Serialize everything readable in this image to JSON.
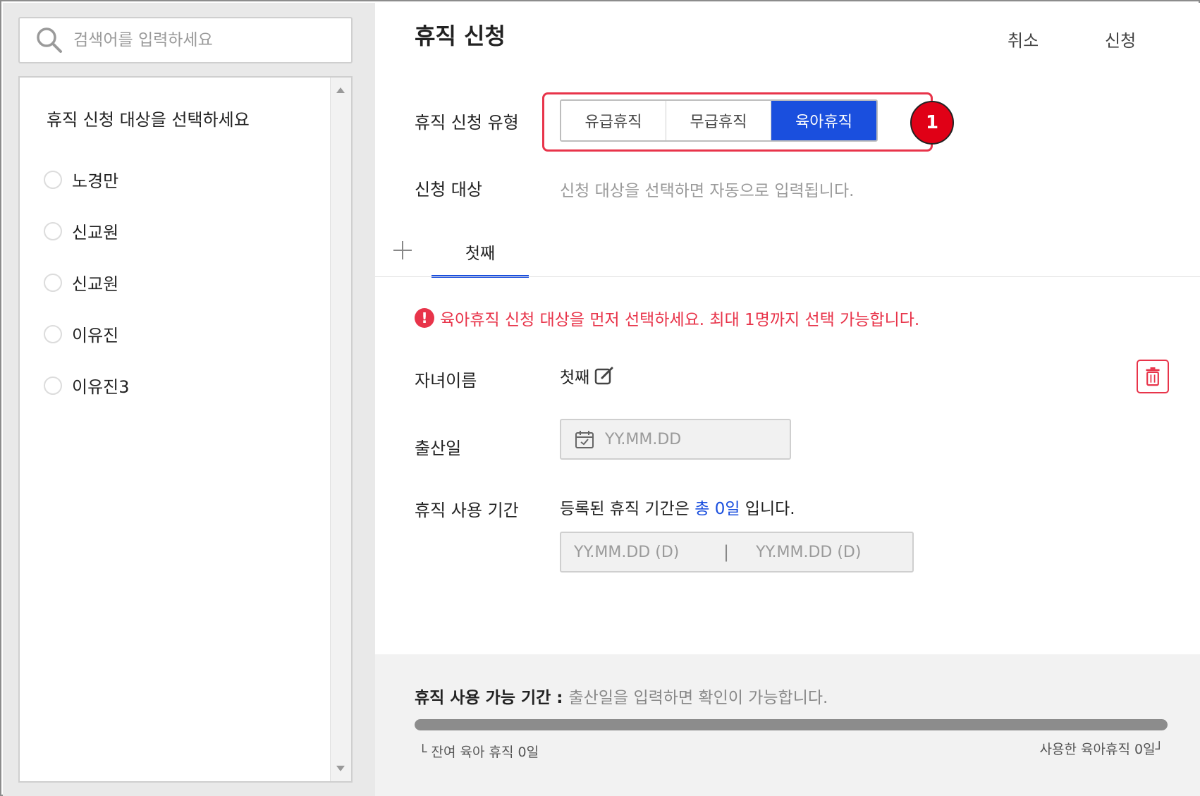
{
  "search": {
    "placeholder": "검색어를 입력하세요",
    "icon": "search-icon"
  },
  "target_list": {
    "title": "휴직 신청 대상을 선택하세요",
    "items": [
      {
        "label": "노경만"
      },
      {
        "label": "신교원"
      },
      {
        "label": "신교원"
      },
      {
        "label": "이유진"
      },
      {
        "label": "이유진3"
      }
    ]
  },
  "header": {
    "title": "휴직 신청",
    "cancel_label": "취소",
    "apply_label": "신청"
  },
  "form": {
    "type_label": "휴직 신청 유형",
    "type_options": [
      "유급휴직",
      "무급휴직",
      "육아휴직"
    ],
    "type_selected": "육아휴직",
    "marker": "1",
    "target_label": "신청 대상",
    "target_hint": "신청 대상을 선택하면 자동으로 입력됩니다."
  },
  "tabs": {
    "items": [
      {
        "label": "첫째"
      }
    ]
  },
  "warning": {
    "icon": "exclamation-icon",
    "text": "육아휴직 신청 대상을 먼저 선택하세요. 최대 1명까지 선택 가능합니다."
  },
  "child": {
    "name_label": "자녀이름",
    "name_value": "첫째",
    "birth_label": "출산일",
    "birth_placeholder": "YY.MM.DD",
    "period_label": "휴직 사용 기간",
    "period_prefix": "등록된 휴직 기간은 ",
    "period_total": "총 0일",
    "period_suffix": " 입니다.",
    "start_placeholder": "YY.MM.DD (D)",
    "end_placeholder": "YY.MM.DD (D)",
    "range_separator": "|"
  },
  "summary": {
    "available_key": "휴직 사용 가능 기간 : ",
    "available_value": "출산일을 입력하면 확인이 가능합니다.",
    "remaining_text": "└ 잔여 육아 휴직 0일",
    "used_text": "사용한 육아휴직 0일┘",
    "progress_fraction": 1.0
  },
  "colors": {
    "accent": "#1a4fde",
    "alert": "#e8344a",
    "marker": "#e00016"
  }
}
